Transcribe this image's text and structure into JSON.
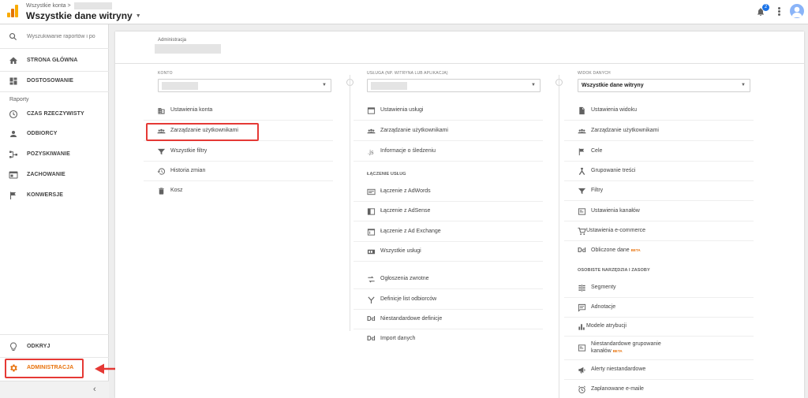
{
  "topbar": {
    "breadcrumb": "Wszystkie konta >",
    "property_title": "Wszystkie dane witryny",
    "notification_count": "2",
    "logo_colors": [
      "#f9ab00",
      "#e37400",
      "#f9ab00"
    ]
  },
  "sidebar": {
    "search_placeholder": "Wyszukiwanie raportów i po",
    "items": [
      {
        "label": "STRONA GŁÓWNA",
        "icon": "home-icon"
      },
      {
        "label": "DOSTOSOWANIE",
        "icon": "dashboard-icon"
      },
      {
        "label": "CZAS RZECZYWISTY",
        "icon": "clock-icon"
      },
      {
        "label": "ODBIORCY",
        "icon": "person-icon"
      },
      {
        "label": "POZYSKIWANIE",
        "icon": "acquisition-icon"
      },
      {
        "label": "ZACHOWANIE",
        "icon": "behavior-icon"
      },
      {
        "label": "KONWERSJE",
        "icon": "flag-icon"
      }
    ],
    "reports_label": "Raporty",
    "discover_label": "ODKRYJ",
    "admin_label": "ADMINISTRACJA",
    "collapse_glyph": "‹"
  },
  "admin": {
    "header_label": "Administracja",
    "account": {
      "header": "KONTO",
      "items": [
        "Ustawienia konta",
        "Zarządzanie użytkownikami",
        "Wszystkie filtry",
        "Historia zmian",
        "Kosz"
      ]
    },
    "property": {
      "header": "USŁUGA (NP. WITRYNA LUB APLIKACJA)",
      "items": [
        "Ustawienia usługi",
        "Zarządzanie użytkownikami",
        "Informacje o śledzeniu"
      ],
      "linking_header": "ŁĄCZENIE USŁUG",
      "linking_items": [
        "Łączenie z AdWords",
        "Łączenie z AdSense",
        "Łączenie z Ad Exchange",
        "Wszystkie usługi"
      ],
      "other_items": [
        "Ogłoszenia zwrotne",
        "Definicje list odbiorców",
        "Niestandardowe definicje",
        "Import danych"
      ]
    },
    "view": {
      "header": "WIDOK DANYCH",
      "selected": "Wszystkie dane witryny",
      "items": [
        "Ustawienia widoku",
        "Zarządzanie użytkownikami",
        "Cele",
        "Grupowanie treści",
        "Filtry",
        "Ustawienia kanałów",
        "Ustawienia e-commerce",
        "Obliczone dane"
      ],
      "beta_label": "BETA",
      "personal_header": "OSOBISTE NARZĘDZIA I ZASOBY",
      "personal_items": [
        "Segmenty",
        "Adnotacje",
        "Modele atrybucji",
        "Niestandardowe grupowanie",
        "kanałów",
        "Alerty niestandardowe",
        "Zaplanowane e-maile"
      ]
    }
  },
  "colors": {
    "accent": "#e8710a",
    "highlight": "#e53935",
    "badge": "#1a73e8"
  }
}
